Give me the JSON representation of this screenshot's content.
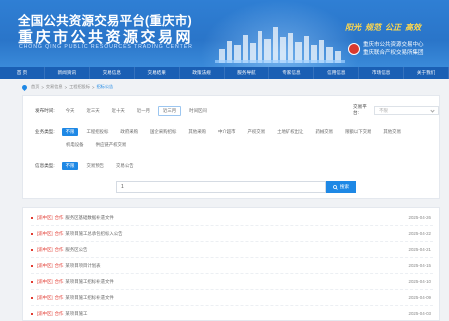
{
  "header": {
    "title_cn": "全国公共资源交易平台(重庆市)",
    "subtitle_cn": "重庆市公共资源交易网",
    "subtitle_en": "CHONG QING PUBLIC RESOURCES TRADING CENTER",
    "slogans": [
      "阳光",
      "规范",
      "公正",
      "高效"
    ],
    "org_lines": [
      "重庆市公共资源交易中心",
      "重庆联合产权交易所集团"
    ]
  },
  "nav": {
    "items": [
      "首 页",
      "新闻资讯",
      "交易信息",
      "交易结果",
      "政策法规",
      "服务导航",
      "专家信息",
      "信用信息",
      "市场信息",
      "关于我们"
    ]
  },
  "breadcrumb": {
    "items": [
      "首页",
      "交易信息",
      "工程招投标",
      "招标公告"
    ]
  },
  "filters": {
    "time_label": "发布时间:",
    "time_options": [
      "今天",
      "近三天",
      "近十天",
      "近一月",
      "近三月",
      "时间区间"
    ],
    "platform_label": "交易平台:",
    "platform_value": "不限",
    "type_label": "业务类型:",
    "type_options": [
      "不限",
      "工程招投标",
      "政府采购",
      "国企采购招标",
      "其他采购",
      "中介超市",
      "产权交易",
      "土地矿权出让",
      "药械交易",
      "限额以下交易",
      "其他交易",
      "机电设备",
      "供应链产权交易"
    ],
    "info_label": "信息类型:",
    "info_options": [
      "不限",
      "交易预告",
      "交易公告"
    ]
  },
  "search": {
    "value": "1",
    "button_label": "搜索"
  },
  "list": {
    "items": [
      {
        "tag": "[渝中区]",
        "district": "合作",
        "title": "服务区基础数据补遗文件",
        "date": "2025-04-26"
      },
      {
        "tag": "[渝中区]",
        "district": "合作",
        "title": "某项目施工总承包招标入公告",
        "date": "2025-04-22"
      },
      {
        "tag": "[渝中区]",
        "district": "合作",
        "title": "服务区公告",
        "date": "2025-04-21"
      },
      {
        "tag": "[渝中区]",
        "district": "合作",
        "title": "某项目项目计划表",
        "date": "2025-04-15"
      },
      {
        "tag": "[渝中区]",
        "district": "合作",
        "title": "某项目施工招标补遗文件",
        "date": "2025-04-10"
      },
      {
        "tag": "[渝中区]",
        "district": "合作",
        "title": "某项目施工招标补遗文件",
        "date": "2025-04-09"
      },
      {
        "tag": "[渝中区]",
        "district": "合作",
        "title": "某项目施工",
        "date": "2025-04-03"
      }
    ]
  },
  "colors": {
    "header_blue": "#2f7fd4",
    "nav_blue": "#1a5fb4",
    "accent": "#1e88e5",
    "tag_red": "#e23c32",
    "slogan_yellow": "#ffd84d"
  }
}
